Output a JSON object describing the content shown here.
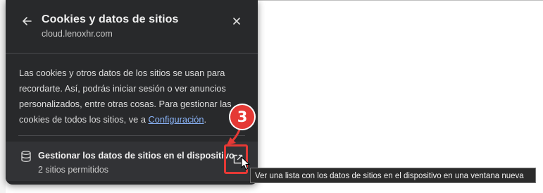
{
  "popup": {
    "title": "Cookies y datos de sitios",
    "subtitle": "cloud.lenoxhr.com",
    "back_icon": "arrow-left-icon",
    "close_icon": "close-icon",
    "description_before_link": "Las cookies y otros datos de los sitios se usan para recordarte. Así, podrás iniciar sesión o ver anuncios personalizados, entre otras cosas. Para gestionar las cookies de todos los sitios, ve a ",
    "description_link": "Configuración",
    "description_after_link": ".",
    "manage_row": {
      "icon": "database-icon",
      "title": "Gestionar los datos de sitios en el dispositivo",
      "subtitle": "2 sitios permitidos",
      "action_icon": "open-in-new-window-icon"
    }
  },
  "annotation": {
    "step_number": "3",
    "color": "#e53935"
  },
  "tooltip": {
    "text": "Ver una lista con los datos de sitios en el dispositivo en una ventana nueva"
  }
}
